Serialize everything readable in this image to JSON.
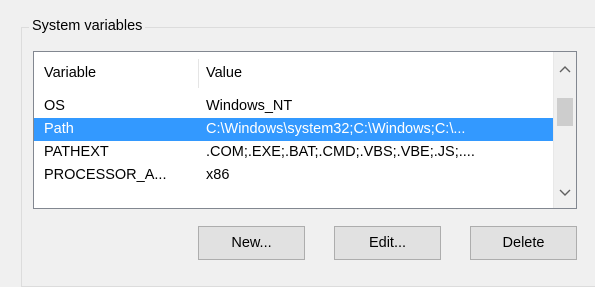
{
  "groupbox": {
    "title": "System variables"
  },
  "list": {
    "columns": {
      "variable": "Variable",
      "value": "Value"
    },
    "rows": [
      {
        "variable": "OS",
        "value": "Windows_NT",
        "selected": false
      },
      {
        "variable": "Path",
        "value": "C:\\Windows\\system32;C:\\Windows;C:\\...",
        "selected": true
      },
      {
        "variable": "PATHEXT",
        "value": ".COM;.EXE;.BAT;.CMD;.VBS;.VBE;.JS;....",
        "selected": false
      },
      {
        "variable": "PROCESSOR_A...",
        "value": "x86",
        "selected": false
      }
    ],
    "selection_color": "#3399ff",
    "scrollbar": {
      "up_icon": "chevron-up-icon",
      "down_icon": "chevron-down-icon",
      "position": 0.25
    }
  },
  "buttons": {
    "new_label": "New...",
    "edit_label": "Edit...",
    "delete_label": "Delete"
  }
}
